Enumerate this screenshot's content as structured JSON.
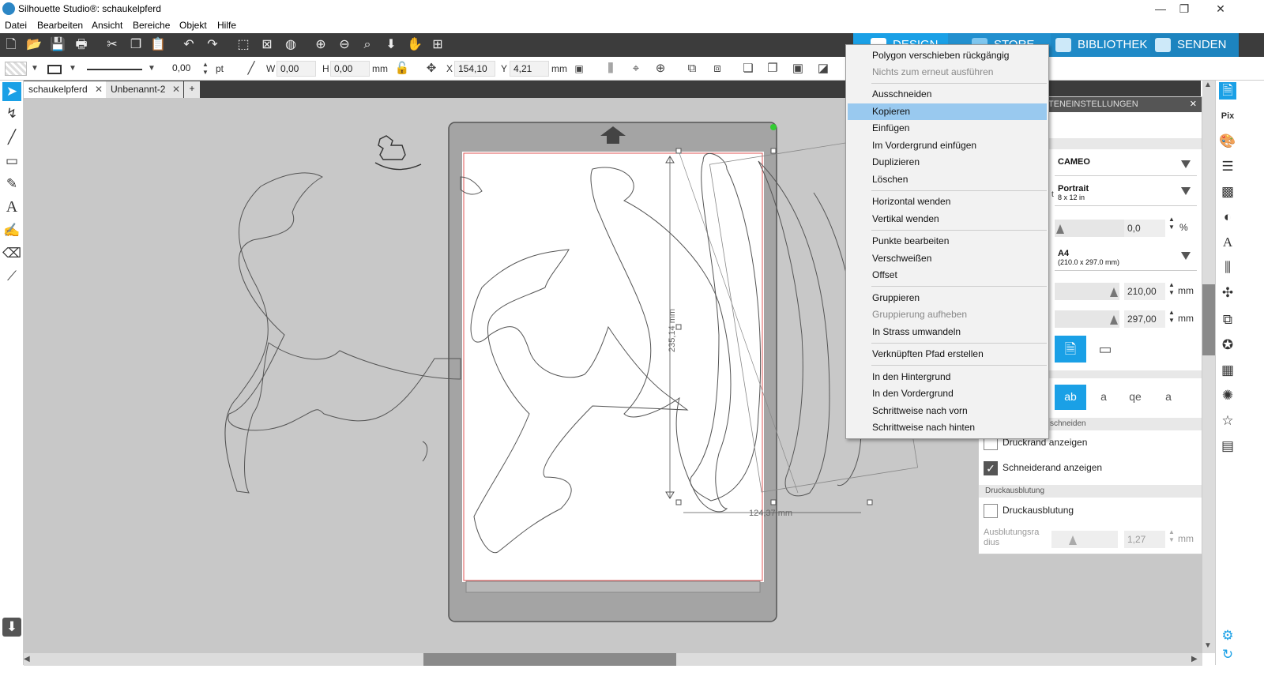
{
  "window": {
    "title": "Silhouette Studio®: schaukelpferd",
    "minimize": "—",
    "maximize": "❐",
    "close": "✕"
  },
  "menu": [
    "Datei",
    "Bearbeiten",
    "Ansicht",
    "Bereiche",
    "Objekt",
    "Hilfe"
  ],
  "top_tabs": {
    "design": "DESIGN",
    "store": "STORE",
    "library": "BIBLIOTHEK",
    "send": "SENDEN"
  },
  "props": {
    "line_width": "0,00",
    "line_unit": "pt",
    "w_label": "W",
    "w_value": "0,00",
    "h_label": "H",
    "h_value": "0,00",
    "size_unit": "mm",
    "x_label": "X",
    "x_value": "154,10",
    "y_label": "Y",
    "y_value": "4,21",
    "pos_unit": "mm"
  },
  "doc_tabs": [
    {
      "label": "schaukelpferd",
      "close": "✕"
    },
    {
      "label": "Unbenannt-2",
      "close": "✕"
    }
  ],
  "add_tab": "+",
  "canvas": {
    "height_dim": "235,14 mm",
    "width_dim": "124,37 mm"
  },
  "context_menu": {
    "items": [
      {
        "label": "Polygon verschieben rückgängig",
        "state": "enabled"
      },
      {
        "label": "Nichts zum erneut ausführen",
        "state": "disabled"
      },
      {
        "label": "Ausschneiden",
        "state": "enabled"
      },
      {
        "label": "Kopieren",
        "state": "highlighted"
      },
      {
        "label": "Einfügen",
        "state": "enabled"
      },
      {
        "label": "Im Vordergrund einfügen",
        "state": "enabled"
      },
      {
        "label": "Duplizieren",
        "state": "enabled"
      },
      {
        "label": "Löschen",
        "state": "enabled"
      },
      {
        "label": "Horizontal wenden",
        "state": "enabled"
      },
      {
        "label": "Vertikal wenden",
        "state": "enabled"
      },
      {
        "label": "Punkte bearbeiten",
        "state": "enabled"
      },
      {
        "label": "Verschweißen",
        "state": "enabled"
      },
      {
        "label": "Offset",
        "state": "enabled"
      },
      {
        "label": "Gruppieren",
        "state": "enabled"
      },
      {
        "label": "Gruppierung aufheben",
        "state": "disabled"
      },
      {
        "label": "In Strass umwandeln",
        "state": "enabled"
      },
      {
        "label": "Verknüpften Pfad erstellen",
        "state": "enabled"
      },
      {
        "label": "In den Hintergrund",
        "state": "enabled"
      },
      {
        "label": "In den Vordergrund",
        "state": "enabled"
      },
      {
        "label": "Schrittweise nach vorn",
        "state": "enabled"
      },
      {
        "label": "Schrittweise nach hinten",
        "state": "enabled"
      }
    ]
  },
  "panel": {
    "title": "TEILENEINSTELLUNGEN",
    "title_visible": "TENEINSTELLUNGEN",
    "close": "✕",
    "machine": "CAMEO",
    "mat_label": "Portrait",
    "mat_sub": "8 x 12 in",
    "mat_prefix": "t",
    "scale_value": "0,0",
    "scale_unit": "%",
    "media": "A4",
    "media_sub": "(210.0 x 297.0 mm)",
    "width_value": "210,00",
    "width_unit": "mm",
    "height_value": "297,00",
    "height_unit": "mm",
    "cut_section": "schneiden",
    "print_border": "Druckrand anzeigen",
    "cut_border": "Schneiderand anzeigen",
    "bleed_section": "Druckausblutung",
    "bleed": "Druckausblutung",
    "bleed_radius_label": "Ausblutungsra dius",
    "bleed_radius_value": "1,27",
    "bleed_radius_unit": "mm"
  },
  "colors": {
    "accent": "#1aa0e6",
    "toolbar_dark": "#3c3c3c",
    "menu_highlight": "#99c9ef",
    "canvas_bg": "#c8c8c8"
  }
}
